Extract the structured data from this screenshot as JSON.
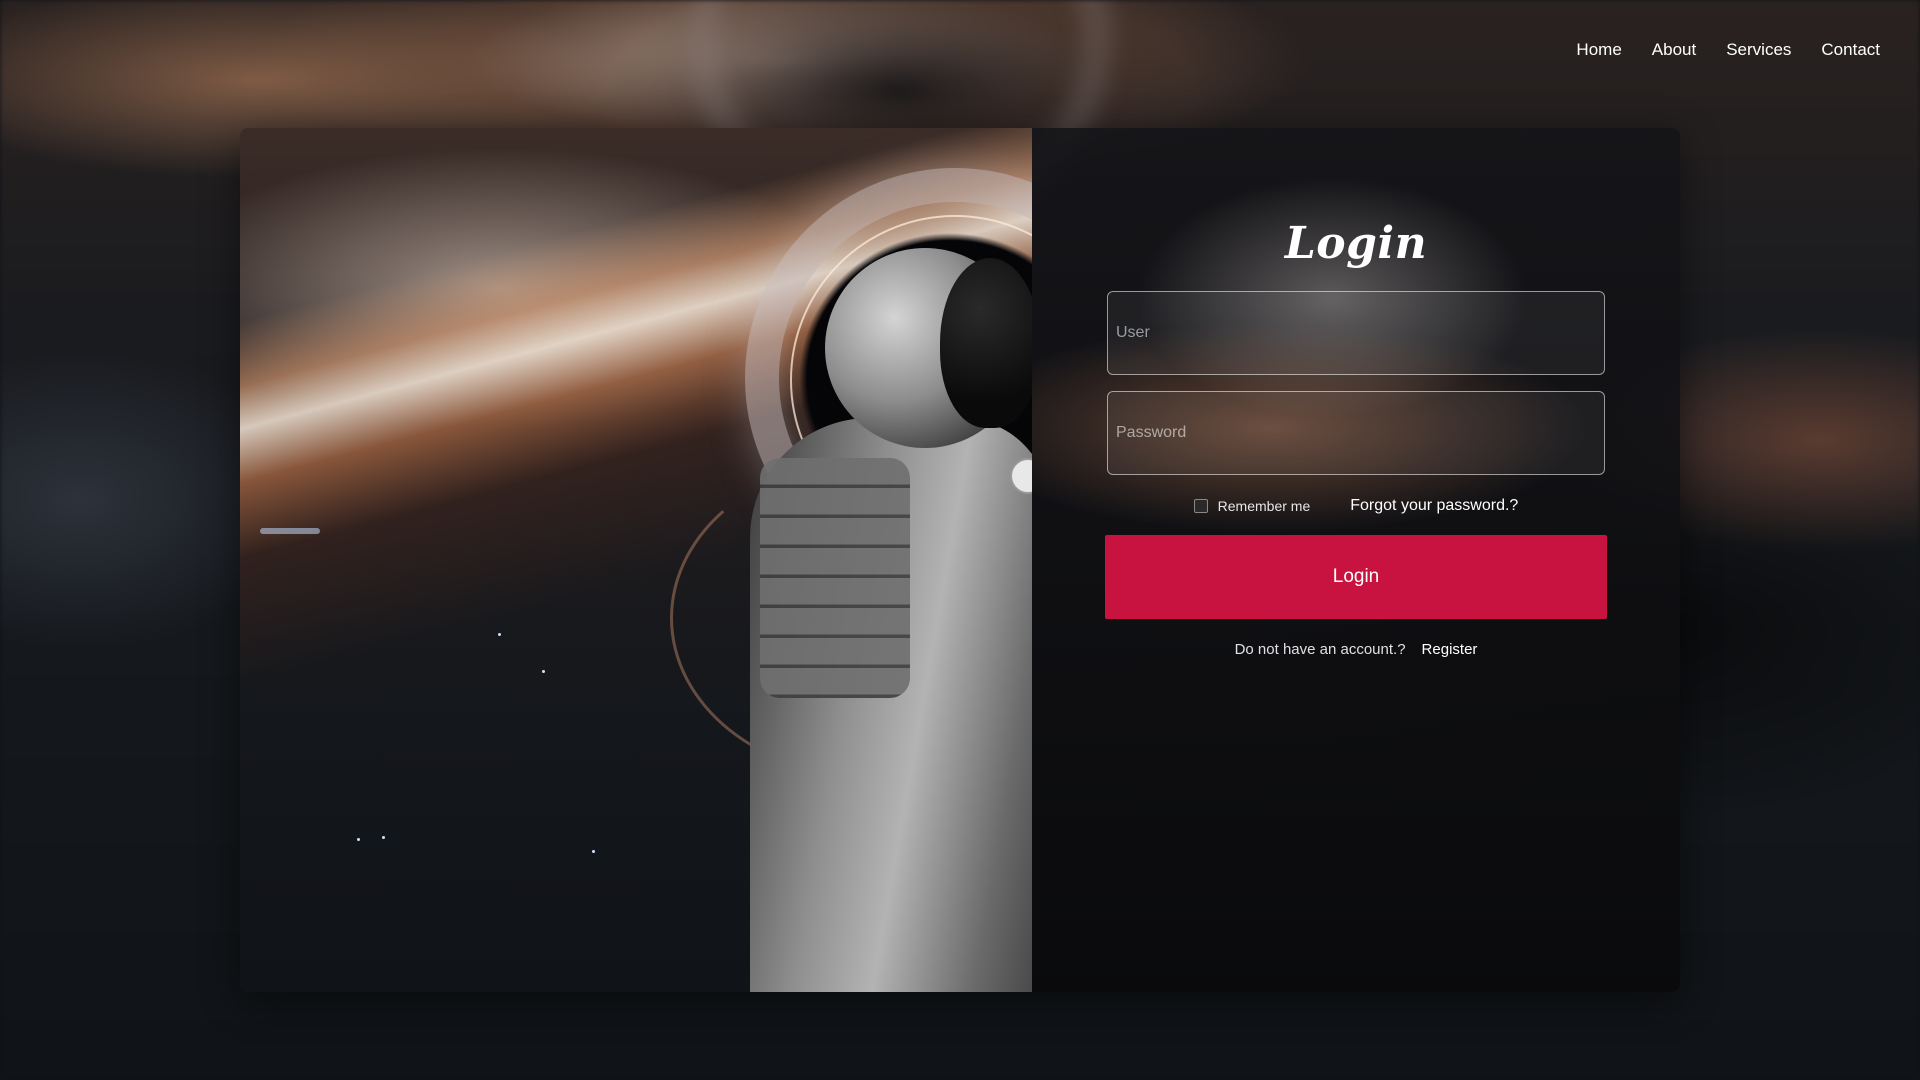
{
  "nav": {
    "items": [
      {
        "label": "Home"
      },
      {
        "label": "About"
      },
      {
        "label": "Services"
      },
      {
        "label": "Contact"
      }
    ]
  },
  "login": {
    "title": "Login",
    "user_placeholder": "User",
    "password_placeholder": "Password",
    "remember_label": "Remember me",
    "remember_checked": false,
    "forgot_label": "Forgot your password.?",
    "submit_label": "Login",
    "no_account_text": "Do not have an account.?",
    "register_label": "Register"
  },
  "theme": {
    "accent": "#c8123f",
    "text": "#ffffff"
  },
  "images": {
    "background": "blurred-black-hole-space",
    "hero": "astronaut-black-hole"
  }
}
